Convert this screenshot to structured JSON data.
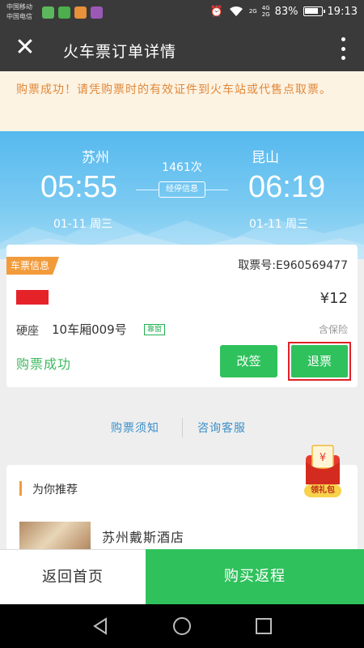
{
  "status_bar": {
    "carrier1": "中国移动",
    "carrier2": "中国电信",
    "net1": "2G",
    "net2_top": "4G",
    "net2_bottom": "2G",
    "battery": "83%",
    "time": "19:13"
  },
  "app_bar": {
    "title": "火车票订单详情"
  },
  "notice": {
    "text": "购票成功！请凭购票时的有效证件到火车站或代售点取票。"
  },
  "trip": {
    "from_station": "苏州",
    "to_station": "昆山",
    "depart_time": "05:55",
    "arrive_time": "06:19",
    "depart_date": "01-11 周三",
    "arrive_date": "01-11 周三",
    "train_no": "1461次",
    "via_label": "经停信息"
  },
  "ticket": {
    "badge": "车票信息",
    "pickup_code": "取票号:E960569477",
    "price": "¥12",
    "seat_type": "硬座",
    "seat_no": "10车厢009号",
    "window_tag": "靠窗",
    "insurance": "含保险",
    "status": "购票成功",
    "change_label": "改签",
    "refund_label": "退票"
  },
  "links": {
    "purchase_notice": "购票须知",
    "customer_service": "咨询客服"
  },
  "gift": {
    "label": "领礼包"
  },
  "recommend": {
    "title": "为你推荐",
    "hotel_name": "苏州戴斯酒店"
  },
  "bottom": {
    "home_label": "返回首页",
    "return_label": "购买返程"
  },
  "colors": {
    "accent_green": "#2fc15c",
    "orange": "#f29b3b",
    "highlight_red": "#e02027"
  }
}
